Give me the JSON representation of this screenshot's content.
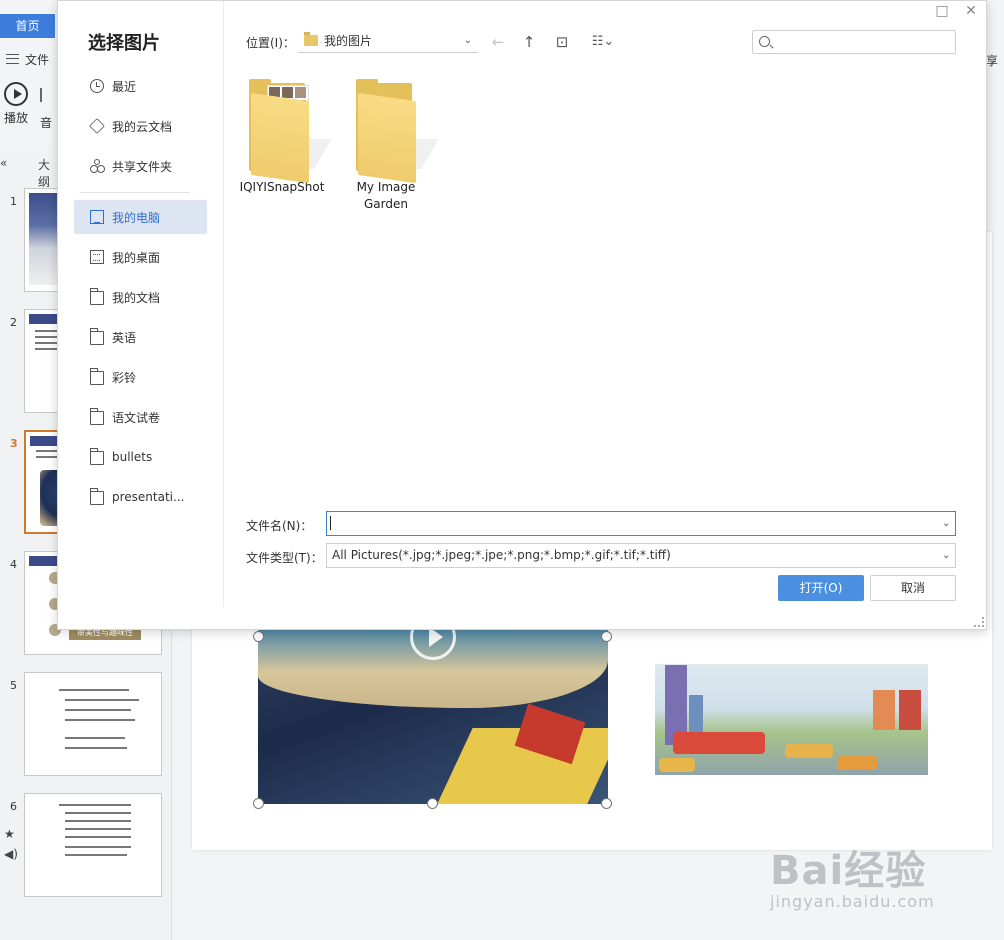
{
  "app": {
    "home_tab": "首页",
    "file_menu": "文件",
    "play_label": "播放",
    "audio_label_fragment": "音",
    "right_fragment": "享",
    "outline_tab_fragment": "大纲",
    "slide_numbers": [
      "1",
      "2",
      "3",
      "4",
      "5",
      "6"
    ],
    "active_slide": "3",
    "slide4_tag": "审美性与趣味性",
    "watermark_main": "Bai经验",
    "watermark_sub": "jingyan.baidu.com"
  },
  "dialog": {
    "title": "选择图片",
    "nav": [
      {
        "label": "最近",
        "icon": "clock-icon"
      },
      {
        "label": "我的云文档",
        "icon": "cloud-doc-icon"
      },
      {
        "label": "共享文件夹",
        "icon": "share-folder-icon"
      },
      {
        "label": "我的电脑",
        "icon": "computer-icon",
        "selected": true
      },
      {
        "label": "我的桌面",
        "icon": "desktop-icon"
      },
      {
        "label": "我的文档",
        "icon": "folder-icon"
      },
      {
        "label": "英语",
        "icon": "folder-icon"
      },
      {
        "label": "彩铃",
        "icon": "folder-icon"
      },
      {
        "label": "语文试卷",
        "icon": "folder-icon"
      },
      {
        "label": "bullets",
        "icon": "folder-icon"
      },
      {
        "label": "presentati...",
        "icon": "folder-icon"
      }
    ],
    "location_label": "位置(I)：",
    "location_value": "我的图片",
    "search_placeholder": "",
    "files": [
      {
        "name": "IQIYISnapShot"
      },
      {
        "name": "My Image Garden"
      }
    ],
    "filename_label": "文件名(N)：",
    "filename_value": "",
    "filetype_label": "文件类型(T)：",
    "filetype_value": "All Pictures(*.jpg;*.jpeg;*.jpe;*.png;*.bmp;*.gif;*.tif;*.tiff)",
    "open_button": "打开(O)",
    "cancel_button": "取消"
  }
}
